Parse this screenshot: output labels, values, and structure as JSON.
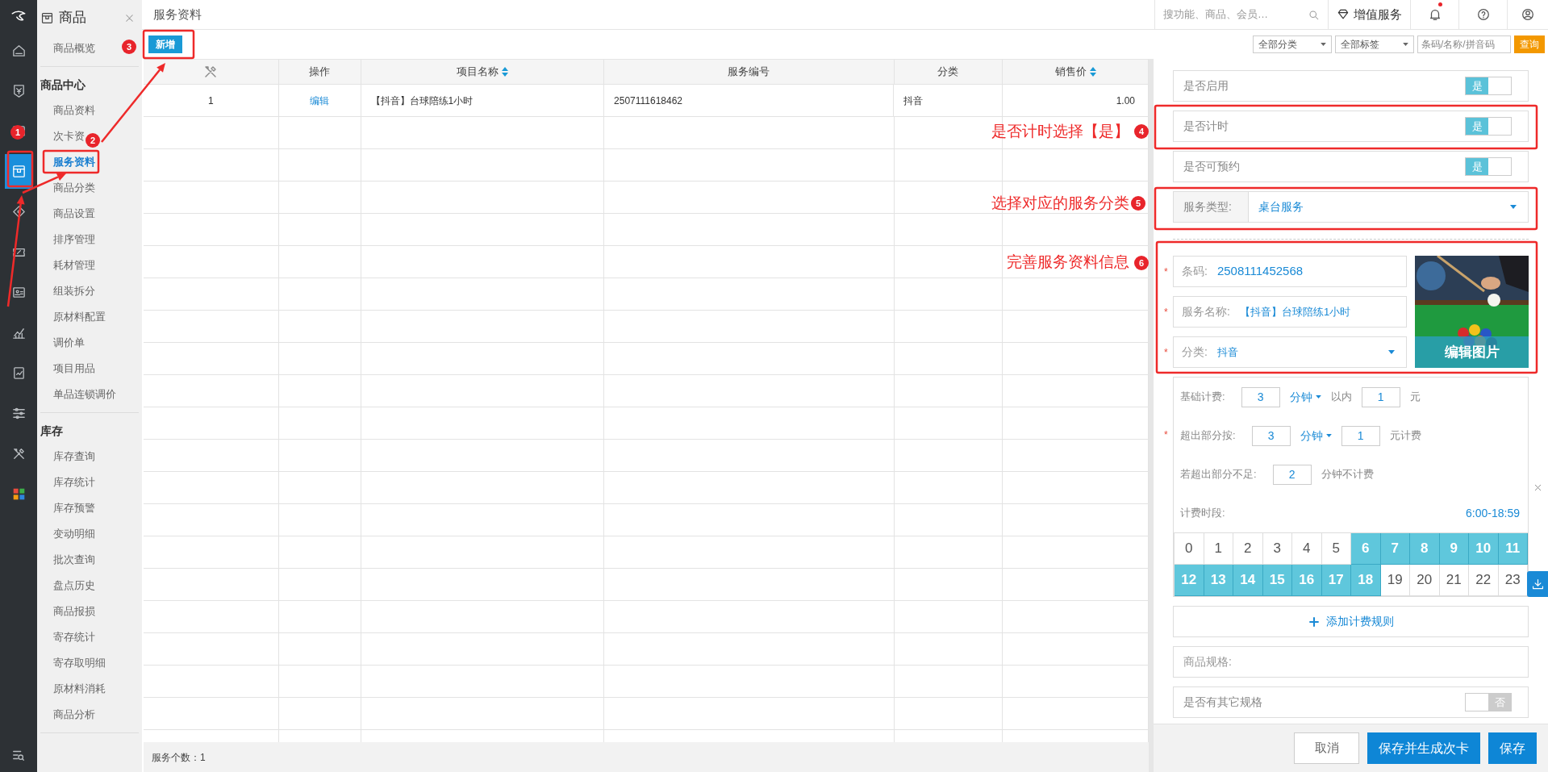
{
  "rail": {
    "items": [
      {
        "selected": false
      },
      {
        "selected": false
      },
      {
        "selected": false
      },
      {
        "selected": true
      },
      {
        "selected": false
      },
      {
        "selected": false
      },
      {
        "selected": false
      },
      {
        "selected": false
      },
      {
        "selected": false
      },
      {
        "selected": false
      },
      {
        "selected": false
      },
      {
        "selected": false
      }
    ]
  },
  "sidebar": {
    "title": "商品",
    "sections": [
      {
        "items": [
          {
            "label": "商品概览",
            "selected": false
          }
        ]
      },
      {
        "heading": "商品中心",
        "items": [
          {
            "label": "商品资料",
            "selected": false
          },
          {
            "label": "次卡资",
            "selected": false
          },
          {
            "label": "服务资料",
            "selected": true
          },
          {
            "label": "商品分类",
            "selected": false
          },
          {
            "label": "商品设置",
            "selected": false
          },
          {
            "label": "排序管理",
            "selected": false
          },
          {
            "label": "耗材管理",
            "selected": false
          },
          {
            "label": "组装拆分",
            "selected": false
          },
          {
            "label": "原材料配置",
            "selected": false
          },
          {
            "label": "调价单",
            "selected": false
          },
          {
            "label": "项目用品",
            "selected": false
          },
          {
            "label": "单品连锁调价",
            "selected": false
          }
        ]
      },
      {
        "heading": "库存",
        "items": [
          {
            "label": "库存查询",
            "selected": false
          },
          {
            "label": "库存统计",
            "selected": false
          },
          {
            "label": "库存预警",
            "selected": false
          },
          {
            "label": "变动明细",
            "selected": false
          },
          {
            "label": "批次查询",
            "selected": false
          },
          {
            "label": "盘点历史",
            "selected": false
          },
          {
            "label": "商品报损",
            "selected": false
          },
          {
            "label": "寄存统计",
            "selected": false
          },
          {
            "label": "寄存取明细",
            "selected": false
          },
          {
            "label": "原材料消耗",
            "selected": false
          },
          {
            "label": "商品分析",
            "selected": false
          }
        ]
      }
    ]
  },
  "page_title": "服务资料",
  "topbar": {
    "search_placeholder": "搜功能、商品、会员…",
    "value_added": "增值服务",
    "notification_dot": true
  },
  "toolbar": {
    "add_button": "新增",
    "filters": [
      {
        "kind": "select",
        "label": "全部分类"
      },
      {
        "kind": "select",
        "label": "全部标签"
      },
      {
        "kind": "input",
        "placeholder": "条码/名称/拼音码"
      }
    ],
    "query_button": "查询"
  },
  "table": {
    "columns": [
      {
        "kind": "index"
      },
      {
        "kind": "link",
        "label": "操作",
        "sortable": false
      },
      {
        "kind": "text",
        "label": "项目名称",
        "sortable": true
      },
      {
        "kind": "text",
        "label": "服务编号",
        "sortable": false
      },
      {
        "kind": "text",
        "label": "分类",
        "sortable": false
      },
      {
        "kind": "number",
        "label": "销售价",
        "sortable": true
      }
    ],
    "rows": [
      {
        "cells": [
          "1",
          "编辑",
          "【抖音】台球陪练1小时",
          "2507111618462",
          "抖音",
          "1.00"
        ]
      }
    ]
  },
  "footer": {
    "count": "服务个数：1"
  },
  "panel": {
    "toggles": [
      {
        "label": "是否启用",
        "on": true,
        "text": "是"
      },
      {
        "label": "是否计时",
        "on": true,
        "text": "是"
      },
      {
        "label": "是否可预约",
        "on": true,
        "text": "是"
      }
    ],
    "service_type": {
      "label": "服务类型:",
      "value": "桌台服务"
    },
    "fields": [
      {
        "kind": "input",
        "label": "条码:",
        "value": "2508111452568",
        "required": true
      },
      {
        "kind": "input",
        "label": "服务名称:",
        "value": "【抖音】台球陪练1小时",
        "required": true
      },
      {
        "kind": "select",
        "label": "分类:",
        "value": "抖音",
        "required": true
      }
    ],
    "required_mark": "*",
    "image_button": "编辑图片",
    "pricing": {
      "rows": [
        {
          "required": false,
          "parts": [
            {
              "kind": "label",
              "text": "基础计费:"
            },
            {
              "kind": "input",
              "value": "3"
            },
            {
              "kind": "unit",
              "text": "分钟"
            },
            {
              "kind": "text",
              "text": "以内"
            },
            {
              "kind": "input",
              "value": "1"
            },
            {
              "kind": "text",
              "text": "元"
            }
          ]
        },
        {
          "required": true,
          "parts": [
            {
              "kind": "label",
              "text": "超出部分按:"
            },
            {
              "kind": "input",
              "value": "3"
            },
            {
              "kind": "unit",
              "text": "分钟"
            },
            {
              "kind": "input",
              "value": "1"
            },
            {
              "kind": "text",
              "text": "元计费"
            }
          ]
        },
        {
          "required": false,
          "parts": [
            {
              "kind": "label",
              "text": "若超出部分不足:"
            },
            {
              "kind": "input",
              "value": "2"
            },
            {
              "kind": "text",
              "text": "分钟不计费"
            }
          ]
        }
      ],
      "period_label": "计费时段:",
      "period_value": "6:00-18:59",
      "hours": [
        {
          "label": "0",
          "selected": false
        },
        {
          "label": "1",
          "selected": false
        },
        {
          "label": "2",
          "selected": false
        },
        {
          "label": "3",
          "selected": false
        },
        {
          "label": "4",
          "selected": false
        },
        {
          "label": "5",
          "selected": false
        },
        {
          "label": "6",
          "selected": true
        },
        {
          "label": "7",
          "selected": true
        },
        {
          "label": "8",
          "selected": true
        },
        {
          "label": "9",
          "selected": true
        },
        {
          "label": "10",
          "selected": true
        },
        {
          "label": "11",
          "selected": true
        },
        {
          "label": "12",
          "selected": true
        },
        {
          "label": "13",
          "selected": true
        },
        {
          "label": "14",
          "selected": true
        },
        {
          "label": "15",
          "selected": true
        },
        {
          "label": "16",
          "selected": true
        },
        {
          "label": "17",
          "selected": true
        },
        {
          "label": "18",
          "selected": true
        },
        {
          "label": "19",
          "selected": false
        },
        {
          "label": "20",
          "selected": false
        },
        {
          "label": "21",
          "selected": false
        },
        {
          "label": "22",
          "selected": false
        },
        {
          "label": "23",
          "selected": false
        }
      ]
    },
    "add_rule": "添加计费规则",
    "spec": {
      "label": "商品规格:"
    },
    "other_spec": {
      "label": "是否有其它规格",
      "on": false,
      "text": "否"
    },
    "buttons": [
      {
        "kind": "secondary",
        "label": "取消"
      },
      {
        "kind": "primary",
        "label": "保存并生成次卡"
      },
      {
        "kind": "primary",
        "label": "保存"
      }
    ]
  },
  "annotations": [
    {
      "number": "1"
    },
    {
      "number": "2"
    },
    {
      "number": "3"
    },
    {
      "number": "4",
      "text": "是否计时选择【是】"
    },
    {
      "number": "5",
      "text": "选择对应的服务分类"
    },
    {
      "number": "6",
      "text": "完善服务资料信息"
    }
  ]
}
